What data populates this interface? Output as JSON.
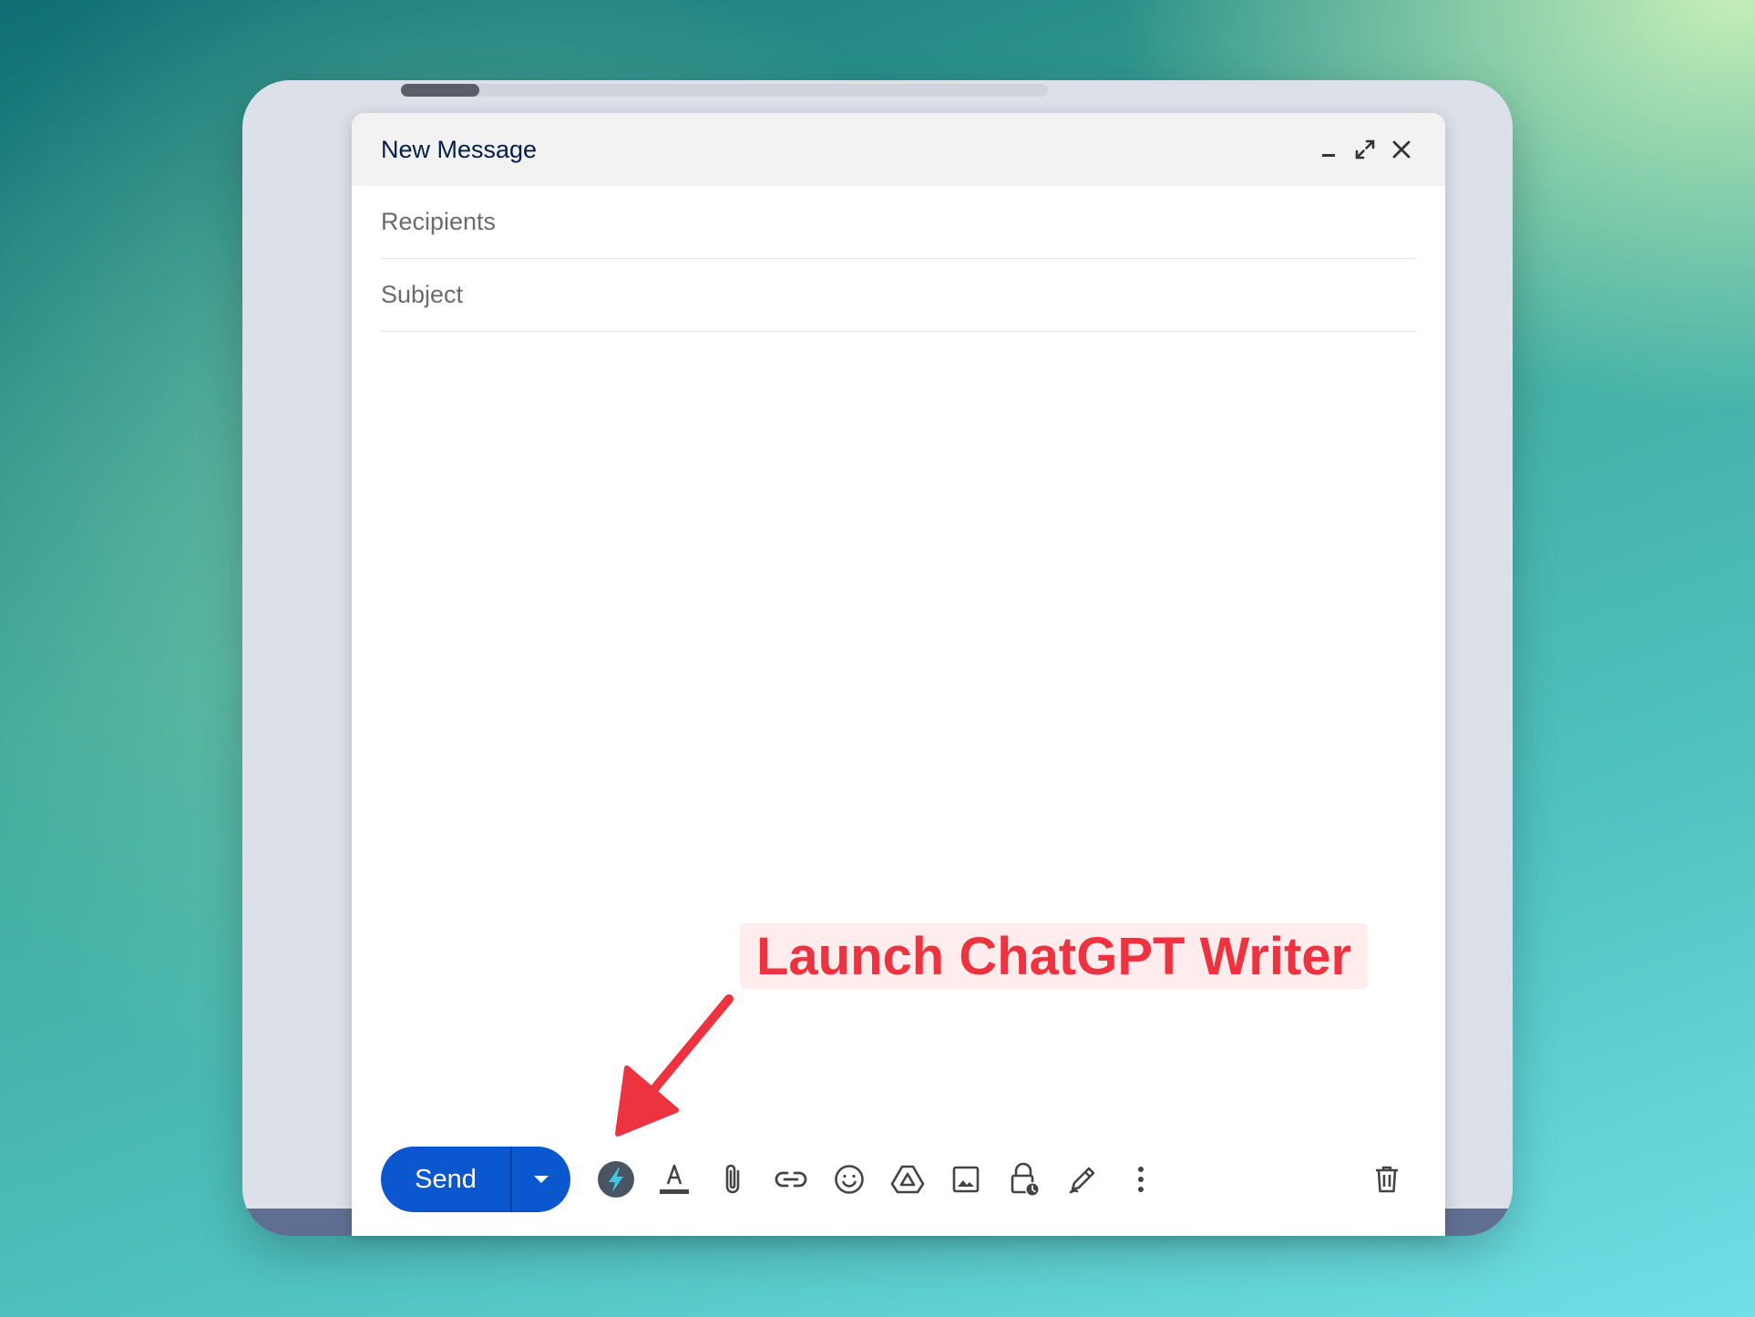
{
  "compose": {
    "title": "New Message",
    "recipients_placeholder": "Recipients",
    "subject_placeholder": "Subject",
    "send_label": "Send"
  },
  "annotation": {
    "text": "Launch ChatGPT Writer"
  },
  "toolbar_icons": [
    "chatgpt-writer-icon",
    "text-format-icon",
    "attach-icon",
    "link-icon",
    "emoji-icon",
    "drive-icon",
    "photo-icon",
    "confidential-mode-icon",
    "signature-icon",
    "more-options-icon",
    "trash-icon"
  ],
  "colors": {
    "send_button": "#0b57d0",
    "annotation": "#ee3340",
    "chatgpt_icon_bg": "#4a5563",
    "chatgpt_bolt": "#3ec8e6"
  }
}
